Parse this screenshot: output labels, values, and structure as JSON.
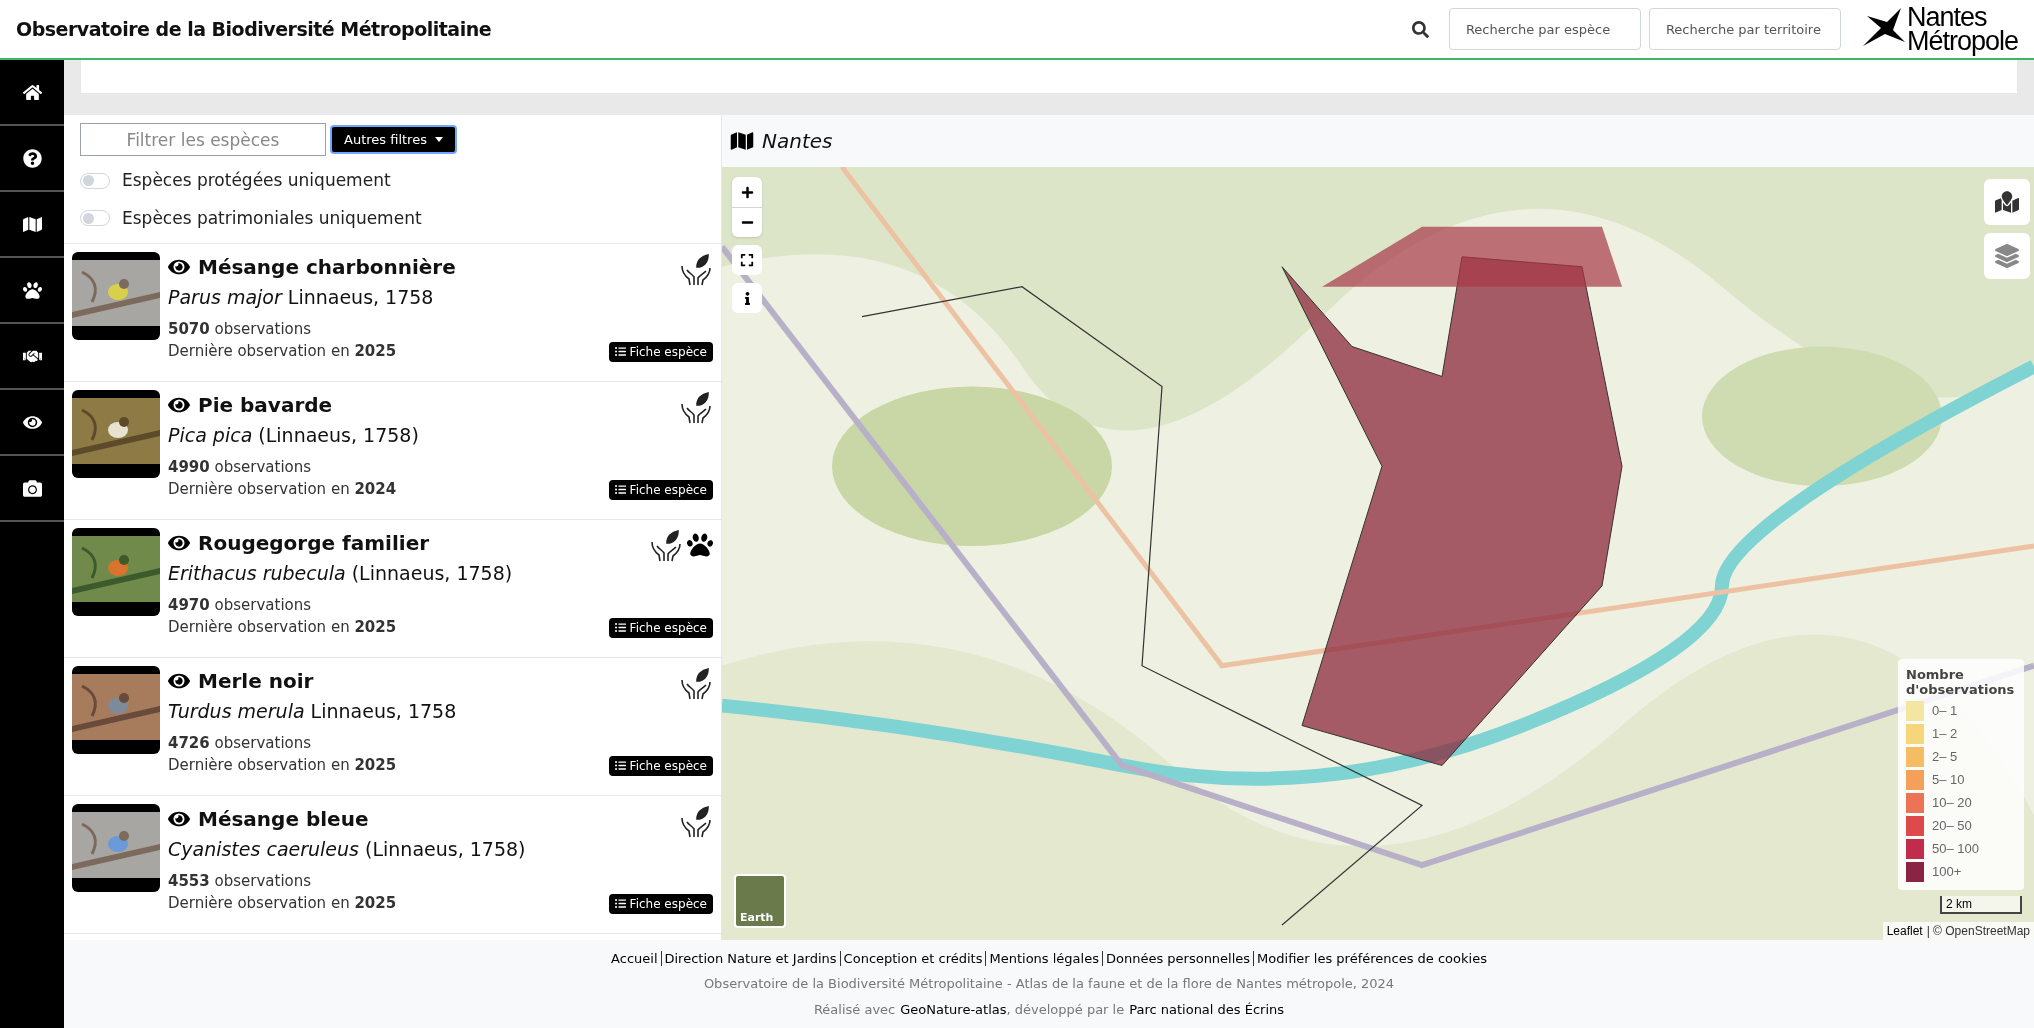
{
  "header": {
    "title": "Observatoire de la Biodiversité Métropolitaine",
    "search_species": {
      "placeholder": "Recherche par espèce"
    },
    "search_territory": {
      "placeholder": "Recherche par territoire"
    },
    "logo": [
      "Nantes",
      "Métropole"
    ]
  },
  "sidebar": {
    "items": [
      {
        "kind": "home",
        "selected": false
      },
      {
        "kind": "help",
        "selected": false
      },
      {
        "kind": "map",
        "selected": false
      },
      {
        "kind": "paw",
        "selected": false
      },
      {
        "kind": "partners",
        "selected": false
      },
      {
        "kind": "eye",
        "selected": false
      },
      {
        "kind": "camera",
        "selected": false
      }
    ]
  },
  "filters": {
    "search": {
      "placeholder": "Filtrer les espèces"
    },
    "more_button": "Autres filtres",
    "toggles": [
      {
        "label": "Espèces protégées uniquement",
        "on": false
      },
      {
        "label": "Espèces patrimoniales uniquement",
        "on": false
      }
    ]
  },
  "species": [
    {
      "name": "Mésange charbonnière",
      "scientific": "*Parus major* Linnaeus, 1758",
      "observations": "**5070** observations",
      "last": "Dernière observation en **2025**",
      "badges": [
        {
          "kind": "protected"
        }
      ],
      "button": "Fiche espèce"
    },
    {
      "name": "Pie bavarde",
      "scientific": "*Pica pica* (Linnaeus, 1758)",
      "observations": "**4990** observations",
      "last": "Dernière observation en **2024**",
      "badges": [
        {
          "kind": "protected"
        }
      ],
      "button": "Fiche espèce"
    },
    {
      "name": "Rougegorge familier",
      "scientific": "*Erithacus rubecula* (Linnaeus, 1758)",
      "observations": "**4970** observations",
      "last": "Dernière observation en **2025**",
      "badges": [
        {
          "kind": "protected"
        },
        {
          "kind": "fauna"
        }
      ],
      "button": "Fiche espèce"
    },
    {
      "name": "Merle noir",
      "scientific": "*Turdus merula* Linnaeus, 1758",
      "observations": "**4726** observations",
      "last": "Dernière observation en **2025**",
      "badges": [
        {
          "kind": "protected"
        }
      ],
      "button": "Fiche espèce"
    },
    {
      "name": "Mésange bleue",
      "scientific": "*Cyanistes caeruleus* (Linnaeus, 1758)",
      "observations": "**4553** observations",
      "last": "Dernière observation en **2025**",
      "badges": [
        {
          "kind": "protected"
        }
      ],
      "button": "Fiche espèce"
    }
  ],
  "map": {
    "title": "Nantes",
    "basemap_button": "Earth",
    "legend": {
      "title": "Nombre d'observations",
      "items": [
        {
          "label": "0– 1",
          "color": "#f2e6a0"
        },
        {
          "label": "1– 2",
          "color": "#f5d67a"
        },
        {
          "label": "2– 5",
          "color": "#f5bc64"
        },
        {
          "label": "5– 10",
          "color": "#f2a05a"
        },
        {
          "label": "10– 20",
          "color": "#ec7356"
        },
        {
          "label": "20– 50",
          "color": "#de4a4c"
        },
        {
          "label": "50– 100",
          "color": "#c22c4c"
        },
        {
          "label": "100+",
          "color": "#8a2444"
        }
      ]
    },
    "scale": "2 km",
    "attribution": {
      "link": "Leaflet",
      "text": "| © OpenStreetMap"
    }
  },
  "footer": {
    "links": [
      "Accueil",
      "Direction Nature et Jardins",
      "Conception et crédits",
      "Mentions légales",
      "Données personnelles",
      "Modifier les préférences de cookies"
    ],
    "copyright": "Observatoire de la Biodiversité Métropolitaine - Atlas de la faune et de la flore de Nantes métropole, 2024",
    "credit": [
      "Réalisé avec",
      "GeoNature-atlas",
      ", développé par le",
      "Parc national des Écrins"
    ]
  }
}
